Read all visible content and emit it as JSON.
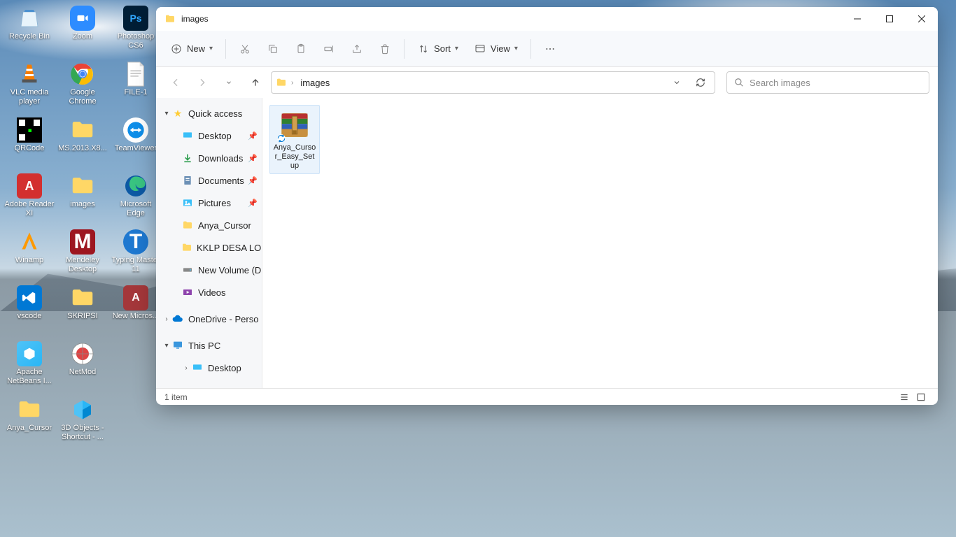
{
  "desktop_icons": [
    {
      "label": "Recycle Bin",
      "icon": "recycle"
    },
    {
      "label": "VLC media player",
      "icon": "vlc"
    },
    {
      "label": "QRCode",
      "icon": "qr"
    },
    {
      "label": "Adobe Reader XI",
      "icon": "adobe"
    },
    {
      "label": "Winamp",
      "icon": "winamp"
    },
    {
      "label": "vscode",
      "icon": "vscode"
    },
    {
      "label": "Apache NetBeans I...",
      "icon": "netbeans"
    },
    {
      "label": "Anya_Cursor",
      "icon": "folder"
    },
    {
      "label": "Zoom",
      "icon": "zoom"
    },
    {
      "label": "Google Chrome",
      "icon": "chrome"
    },
    {
      "label": "MS.2013.X8...",
      "icon": "folder"
    },
    {
      "label": "images",
      "icon": "folder"
    },
    {
      "label": "Mendeley Desktop",
      "icon": "mendeley"
    },
    {
      "label": "SKRIPSI",
      "icon": "folder"
    },
    {
      "label": "NetMod",
      "icon": "netmod"
    },
    {
      "label": "3D Objects - Shortcut - ...",
      "icon": "3d"
    },
    {
      "label": "Photoshop CS6",
      "icon": "ps"
    },
    {
      "label": "FILE-1",
      "icon": "doc"
    },
    {
      "label": "TeamViewer",
      "icon": "teamviewer"
    },
    {
      "label": "Microsoft Edge",
      "icon": "edge"
    },
    {
      "label": "Typing Master 11",
      "icon": "typing"
    },
    {
      "label": "New Micros...",
      "icon": "access"
    }
  ],
  "window": {
    "title": "images",
    "ribbon": {
      "new": "New",
      "sort": "Sort",
      "view": "View"
    },
    "breadcrumb": [
      "images"
    ],
    "search_placeholder": "Search images",
    "sidebar": {
      "quick_access": "Quick access",
      "items": [
        {
          "label": "Desktop",
          "icon": "desktop",
          "pinned": true
        },
        {
          "label": "Downloads",
          "icon": "downloads",
          "pinned": true
        },
        {
          "label": "Documents",
          "icon": "documents",
          "pinned": true
        },
        {
          "label": "Pictures",
          "icon": "pictures",
          "pinned": true
        },
        {
          "label": "Anya_Cursor",
          "icon": "folder",
          "pinned": false
        },
        {
          "label": "KKLP DESA LOR",
          "icon": "folder",
          "pinned": false
        },
        {
          "label": "New Volume (D",
          "icon": "drive",
          "pinned": false
        },
        {
          "label": "Videos",
          "icon": "videos",
          "pinned": false
        }
      ],
      "onedrive": "OneDrive - Perso",
      "thispc": "This PC",
      "thispc_children": [
        {
          "label": "Desktop",
          "icon": "desktop"
        }
      ]
    },
    "files": [
      {
        "name": "Anya_Cursor_Easy_Setup",
        "icon": "rar"
      }
    ],
    "status": "1 item"
  }
}
